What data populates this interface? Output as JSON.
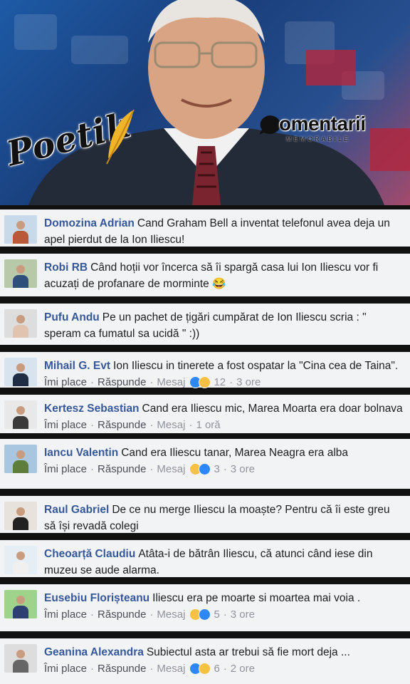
{
  "header": {
    "brand_left": "Poetik",
    "brand_right_word": "omentarii",
    "brand_right_sub": "MEMORABILE"
  },
  "comments": [
    {
      "author": "Domozina Adrian",
      "text": "Cand Graham Bell a inventat telefonul avea deja un apel pierdut de la Ion Iliescu!",
      "actions": false
    },
    {
      "author": "Robi RB",
      "text": "Când hoții vor încerca să îi spargă casa lui Ion Iliescu vor fi acuzați de profanare de morminte 😂",
      "actions": false
    },
    {
      "author": "Pufu Andu",
      "text": "Pe un pachet de țigări cumpărat de Ion Iliescu scria : \" speram ca fumatul sa ucidă \" :))",
      "actions": false
    },
    {
      "author": "Mihail G. Evt",
      "text": "Ion Iliescu in tinerete a fost ospatar la \"Cina cea de Taina\".",
      "actions": true,
      "like": "Îmi place",
      "reply": "Răspunde",
      "msg": "Mesaj",
      "reactions": [
        "like",
        "haha"
      ],
      "count": "12",
      "time": "3 ore"
    },
    {
      "author": "Kertesz Sebastian",
      "text": "Cand era Iliescu mic, Marea Moarta era doar bolnava",
      "actions": true,
      "like": "Îmi place",
      "reply": "Răspunde",
      "msg": "Mesaj",
      "reactions": [],
      "count": "",
      "time": "1 oră"
    },
    {
      "author": "Iancu Valentin",
      "text": "Cand era Iliescu tanar, Marea Neagra era alba",
      "actions": true,
      "like": "Îmi place",
      "reply": "Răspunde",
      "msg": "Mesaj",
      "reactions": [
        "haha",
        "like"
      ],
      "count": "3",
      "time": "3 ore"
    },
    {
      "author": "Raul Gabriel",
      "text": "De ce nu merge Iliescu la moaște? Pentru că îi este greu să își revadă colegi",
      "actions": false
    },
    {
      "author": "Cheoarță Claudiu",
      "text": "Atâta-i de bătrân Iliescu, că atunci când iese din muzeu se aude alarma.",
      "actions": false
    },
    {
      "author": "Eusebiu Florișteanu",
      "text": "Iliescu era pe moarte si moartea mai voia .",
      "actions": true,
      "like": "Îmi place",
      "reply": "Răspunde",
      "msg": "Mesaj",
      "reactions": [
        "haha",
        "like"
      ],
      "count": "5",
      "time": "3 ore"
    },
    {
      "author": "Geanina Alexandra",
      "text": "Subiectul asta ar trebui să fie mort deja ...",
      "actions": true,
      "like": "Îmi place",
      "reply": "Răspunde",
      "msg": "Mesaj",
      "reactions": [
        "like",
        "haha"
      ],
      "count": "6",
      "time": "2 ore"
    }
  ]
}
